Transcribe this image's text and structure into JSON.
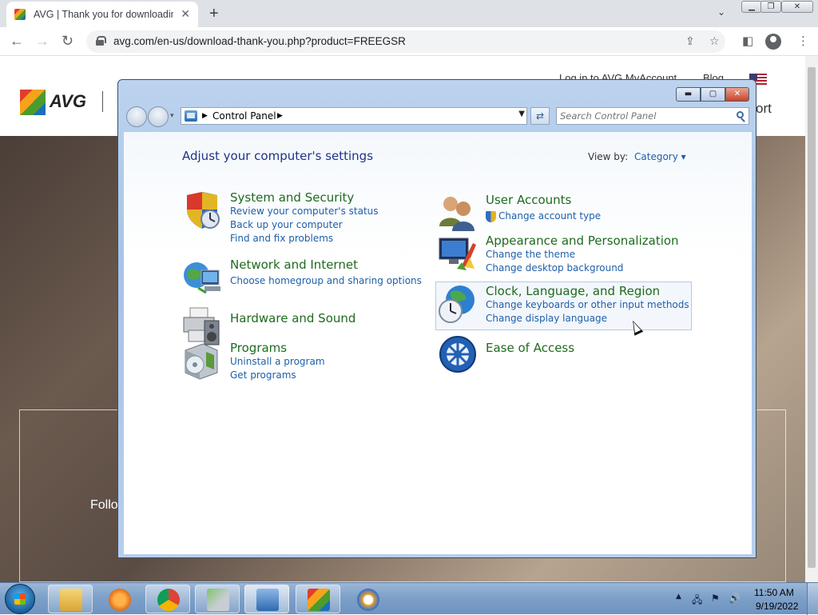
{
  "browser": {
    "tab_title": "AVG | Thank you for downloadin",
    "tab_close": "✕",
    "new_tab": "+",
    "tab_search": "⌄",
    "win_minimize": "▁",
    "win_restore": "❐",
    "win_close": "✕",
    "url": "avg.com/en-us/download-thank-you.php?product=FREEGSR",
    "back": "←",
    "forward": "→",
    "reload": "↻"
  },
  "avg_page": {
    "logo_text": "AVG",
    "top_link_account": "Log in to AVG MyAccount",
    "top_link_blog": "Blog",
    "nav_partial": "ort",
    "hero_text": "Follo"
  },
  "control_panel": {
    "breadcrumb_root": "Control Panel",
    "search_placeholder": "Search Control Panel",
    "heading": "Adjust your computer's settings",
    "view_by_label": "View by:",
    "view_by_value": "Category ▾",
    "btn_min": "▬",
    "btn_max": "▢",
    "btn_close": "✕",
    "categories": {
      "system": {
        "title": "System and Security",
        "links": [
          "Review your computer's status",
          "Back up your computer",
          "Find and fix problems"
        ]
      },
      "network": {
        "title": "Network and Internet",
        "links": [
          "Choose homegroup and sharing options"
        ]
      },
      "hardware": {
        "title": "Hardware and Sound",
        "links": []
      },
      "programs": {
        "title": "Programs",
        "links": [
          "Uninstall a program",
          "Get programs"
        ]
      },
      "user_accounts": {
        "title": "User Accounts",
        "links": [
          "Change account type"
        ]
      },
      "appearance": {
        "title": "Appearance and Personalization",
        "links": [
          "Change the theme",
          "Change desktop background"
        ]
      },
      "clock": {
        "title": "Clock, Language, and Region",
        "links": [
          "Change keyboards or other input methods",
          "Change display language"
        ]
      },
      "ease": {
        "title": "Ease of Access",
        "links": []
      }
    }
  },
  "taskbar": {
    "time": "11:50 AM",
    "date": "9/19/2022",
    "tray_arrow": "▲"
  },
  "colors": {
    "category_title": "#1e6b1e",
    "link": "#1e5fa8",
    "heading": "#1e3287"
  }
}
